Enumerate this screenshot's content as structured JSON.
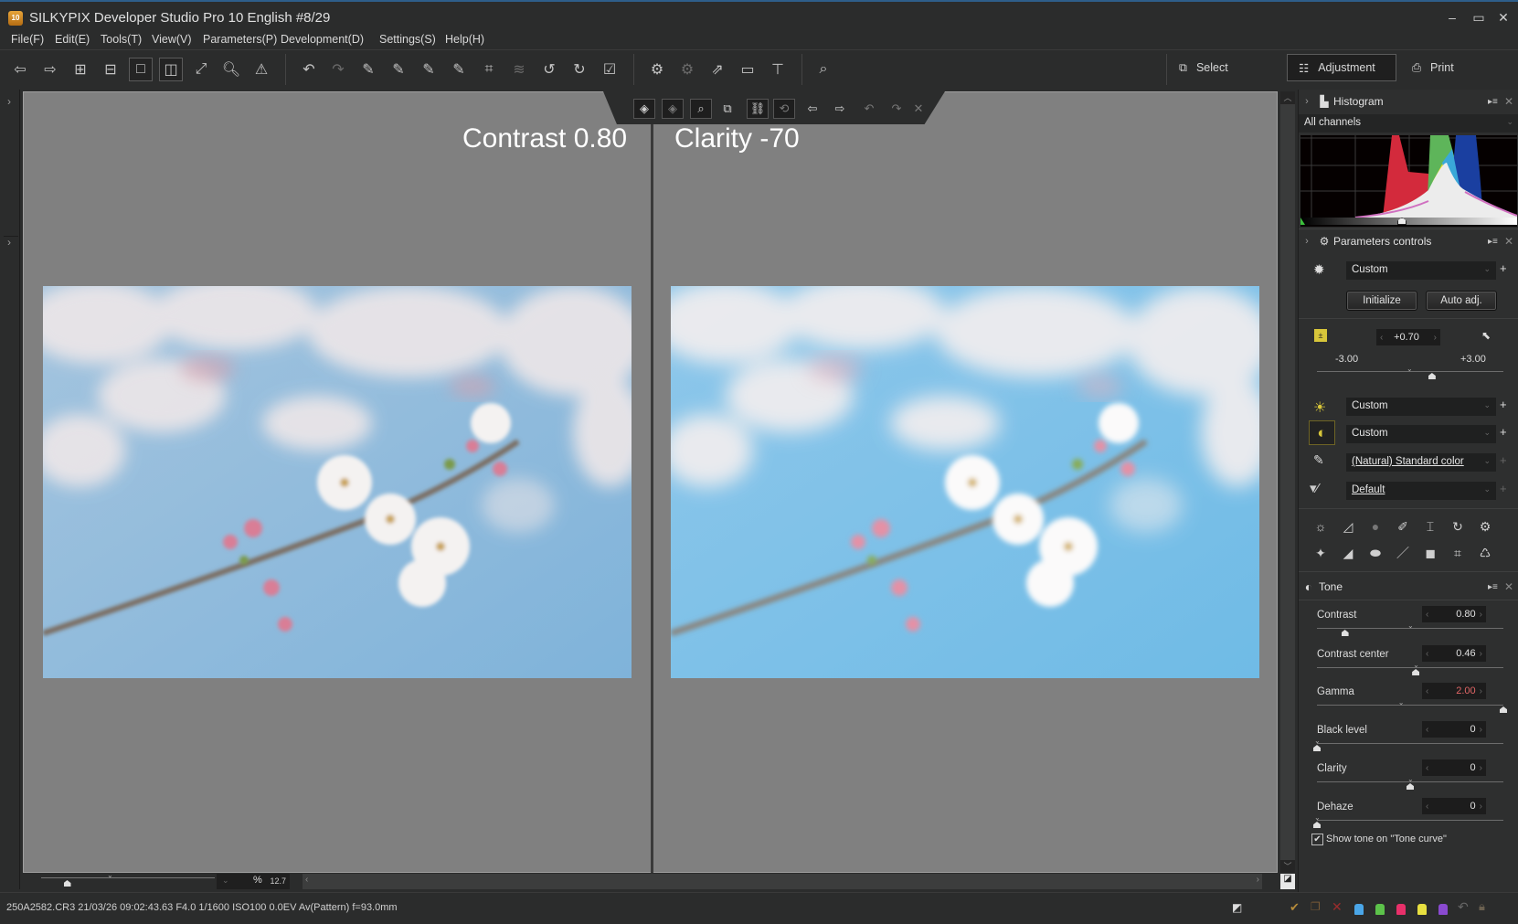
{
  "window": {
    "app_icon_label": "10",
    "title": "SILKYPIX Developer Studio Pro 10 English   #8/29",
    "controls": {
      "minimize": "–",
      "maximize": "▭",
      "close": "✕"
    }
  },
  "menu": [
    "File(F)",
    "Edit(E)",
    "Tools(T)",
    "View(V)",
    "Parameters(P)",
    "Development(D)",
    "Settings(S)",
    "Help(H)"
  ],
  "toolbar": {
    "icons": [
      "previous-photo-icon",
      "next-photo-icon",
      "thumbnail-grid-icon",
      "thumbnail-filmstrip-icon",
      "single-view-icon",
      "compare-view-icon",
      "fullscreen-icon",
      "loupe-icon",
      "warning-icon",
      "undo-icon",
      "redo-icon",
      "paste-exposure-icon",
      "paste-tone-icon",
      "paste-contrast-icon",
      "paste-film-icon",
      "transform-icon",
      "layers-icon",
      "rotate-left-icon",
      "rotate-right-icon",
      "check-mark-icon",
      "save-parameter-icon",
      "apply-parameter-icon",
      "export-icon",
      "slideshow-icon",
      "hammer-icon",
      "find-icon"
    ],
    "modes": [
      {
        "label": "Select",
        "icon": "select-mode-icon",
        "active": false
      },
      {
        "label": "Adjustment",
        "icon": "adjustment-mode-icon",
        "active": true
      },
      {
        "label": "Print",
        "icon": "printer-icon",
        "active": false
      }
    ]
  },
  "viewer": {
    "left_caption": "Contrast 0.80",
    "right_caption": "Clarity -70",
    "zoom_value": "12.7",
    "zoom_unit": "%",
    "zoom_slider_fraction": 0.15
  },
  "status": {
    "file_info": "250A2582.CR3 21/03/26 09:02:43.63 F4.0 1/1600 ISO100  0.0EV Av(Pattern) f=93.0mm",
    "tag_colors": [
      "#4aa6e8",
      "#5cc24a",
      "#e8306a",
      "#e8e040",
      "#8a4ad0"
    ]
  },
  "panel": {
    "histogram": {
      "title": "Histogram",
      "channel": "All channels"
    },
    "parameters": {
      "title": "Parameters controls",
      "preset": "Custom",
      "initialize_label": "Initialize",
      "auto_adj_label": "Auto adj.",
      "exposure_value": "+0.70",
      "exposure_min": "-3.00",
      "exposure_max": "+3.00",
      "exposure_fraction": 0.617,
      "white_balance": "Custom",
      "tone": "Custom",
      "color": "(Natural) Standard color",
      "sharpness": "Default"
    },
    "tone": {
      "title": "Tone",
      "sliders": [
        {
          "label": "Contrast",
          "value": "0.80",
          "fraction": 0.15,
          "default": 0.5,
          "modified": false
        },
        {
          "label": "Contrast center",
          "value": "0.46",
          "fraction": 0.53,
          "default": 0.53,
          "modified": false
        },
        {
          "label": "Gamma",
          "value": "2.00",
          "fraction": 1.0,
          "default": 0.45,
          "modified": true
        },
        {
          "label": "Black level",
          "value": "0",
          "fraction": 0.0,
          "default": 0.0,
          "modified": false
        },
        {
          "label": "Clarity",
          "value": "0",
          "fraction": 0.5,
          "default": 0.5,
          "modified": false
        },
        {
          "label": "Dehaze",
          "value": "0",
          "fraction": 0.0,
          "default": 0.0,
          "modified": false
        }
      ],
      "show_tone_label": "Show tone on \"Tone curve\"",
      "show_tone_checked": true
    }
  }
}
